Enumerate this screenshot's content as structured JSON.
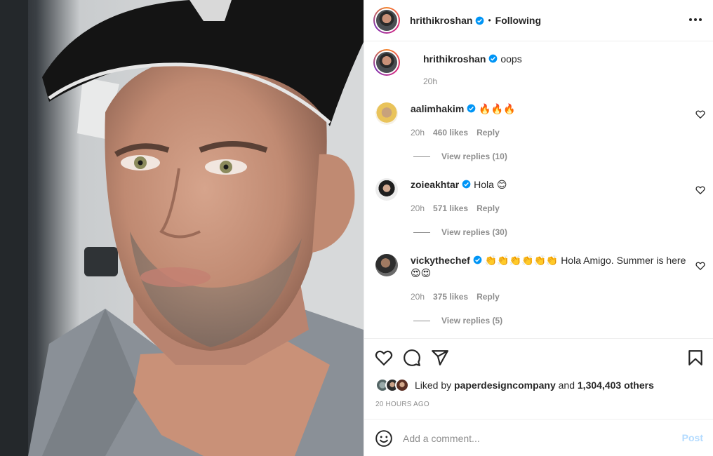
{
  "post": {
    "author": "hrithikroshan",
    "follow_status": "Following",
    "separator": "•",
    "more_icon": "more-horizontal-icon"
  },
  "caption": {
    "author": "hrithikroshan",
    "text": "oops",
    "time": "20h"
  },
  "comments": [
    {
      "user": "aalimhakim",
      "text": "🔥🔥🔥",
      "time": "20h",
      "likes": "460 likes",
      "reply": "Reply",
      "replies": "View replies (10)"
    },
    {
      "user": "zoieakhtar",
      "text": "Hola 😊",
      "time": "20h",
      "likes": "571 likes",
      "reply": "Reply",
      "replies": "View replies (30)"
    },
    {
      "user": "vickythechef",
      "text": "👏👏👏👏👏👏 Hola Amigo. Summer is here 😍😍",
      "time": "20h",
      "likes": "375 likes",
      "reply": "Reply",
      "replies": "View replies (5)"
    }
  ],
  "actions": {
    "icons": [
      "heart-icon",
      "comment-icon",
      "share-icon",
      "bookmark-icon"
    ]
  },
  "likes": {
    "prefix": "Liked by",
    "first_liker": "paperdesigncompany",
    "joiner": "and",
    "others": "1,304,403 others"
  },
  "timestamp": "20 HOURS AGO",
  "add_comment": {
    "placeholder": "Add a comment...",
    "post_label": "Post"
  },
  "colors": {
    "verified": "#0095f6",
    "muted": "#8e8e8e",
    "post_disabled": "#b3dbff"
  }
}
